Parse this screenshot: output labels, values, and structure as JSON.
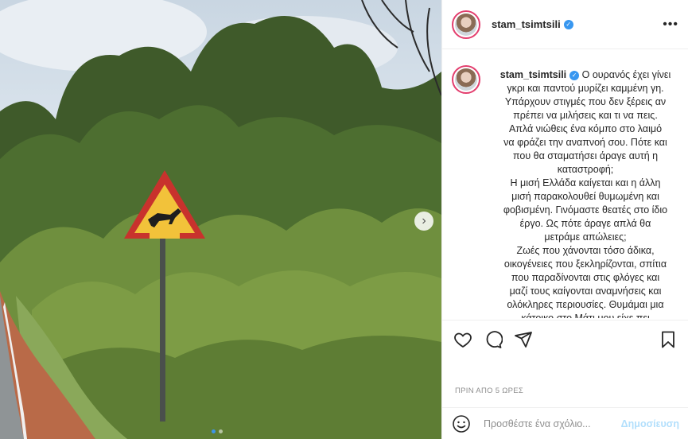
{
  "post": {
    "username": "stam_tsimtsili",
    "caption_lines": [
      "Ο ουρανός έχει γίνει",
      "γκρι και παντού μυρίζει καμμένη γη.",
      "Υπάρχουν στιγμές που δεν ξέρεις αν",
      "πρέπει να μιλήσεις και τι να πεις.",
      "Απλά νιώθεις ένα κόμπο στο λαιμό",
      "να φράζει την αναπνοή σου. Πότε και",
      "που θα σταματήσει άραγε αυτή η",
      "καταστροφή;",
      "Η μισή Ελλάδα καίγεται και η άλλη",
      "μισή παρακολουθεί θυμωμένη και",
      "φοβισμένη. Γινόμαστε θεατές στο ίδιο",
      "έργο. Ως πότε άραγε απλά θα",
      "μετράμε απώλειες;",
      "Ζωές που χάνονται τόσο άδικα,",
      "οικογένειες που ξεκληρίζονται, σπίτια",
      "που παραδίνονται στις φλόγες και",
      "μαζί τους καίγονται αναμνήσεις και",
      "ολόκληρες περιουσίες. Θυμάμαι μια",
      "κάτοικο στο Μάτι μου είχε πει"
    ],
    "timestamp": "ΠΡΙΝ ΑΠΟ 5 ΩΡΕΣ",
    "comment_placeholder": "Προσθέστε ένα σχόλιο...",
    "post_button": "Δημοσίευση",
    "more_glyph": "•••",
    "next_glyph": "›",
    "verified_glyph": "✓"
  },
  "carousel": {
    "total": 2,
    "active": 0
  },
  "icons": [
    "heart-icon",
    "comment-icon",
    "share-icon",
    "save-icon",
    "emoji-icon",
    "more-options-icon",
    "verified-icon"
  ],
  "colors": {
    "verified": "#3897f0",
    "post_button": "#b2dffc",
    "story_ring": "#e33e6e",
    "dot_active": "#3d95e8"
  }
}
